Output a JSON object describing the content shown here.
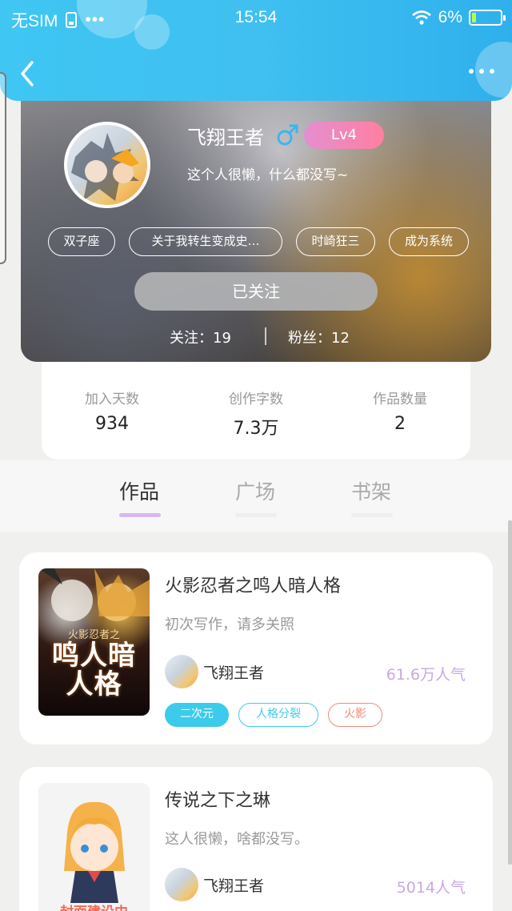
{
  "status_bar": {
    "carrier": "无SIM",
    "time": "15:54",
    "battery": "6%",
    "battery_level": 0.06
  },
  "icons": {
    "back": "chevron-left-icon",
    "more": "more-dots-icon",
    "gender": "male-icon",
    "wifi": "wifi-icon",
    "sim": "sim-icon",
    "battery": "battery-icon"
  },
  "profile": {
    "nickname": "飞翔王者",
    "level": "Lv4",
    "bio": "这个人很懒，什么都没写~",
    "tags": [
      "双子座",
      "关于我转生变成史…",
      "时崎狂三",
      "成为系统"
    ],
    "follow_button": "已关注",
    "following_label": "关注：19",
    "followers_label": "粉丝：12"
  },
  "stats": [
    {
      "label": "加入天数",
      "value": "934"
    },
    {
      "label": "创作字数",
      "value": "7.3万"
    },
    {
      "label": "作品数量",
      "value": "2"
    }
  ],
  "tabs": [
    {
      "label": "作品",
      "active": true
    },
    {
      "label": "广场",
      "active": false
    },
    {
      "label": "书架",
      "active": false
    }
  ],
  "books": [
    {
      "title": "火影忍者之鸣人暗人格",
      "description": "初次写作，请多关照",
      "author": "飞翔王者",
      "popularity": "61.6万人气",
      "cover_text": "鸣人暗人格",
      "cover_subtitle": "火影忍者之",
      "tags": [
        {
          "label": "二次元",
          "color": "#3ccbeb",
          "filled": true
        },
        {
          "label": "人格分裂",
          "color": "#3ccbeb",
          "filled": false
        },
        {
          "label": "火影",
          "color": "#f08a7a",
          "filled": false
        }
      ]
    },
    {
      "title": "传说之下之琳",
      "description": "这人很懒，啥都没写。",
      "author": "飞翔王者",
      "popularity": "5014人气",
      "cover_text": "封面建设中"
    }
  ],
  "colors": {
    "header_blue": "#3fc6f3",
    "level_pink": "#e48fd0",
    "tab_active_underline": "#d7b8ee",
    "popularity_purple": "#c9a8e6"
  }
}
